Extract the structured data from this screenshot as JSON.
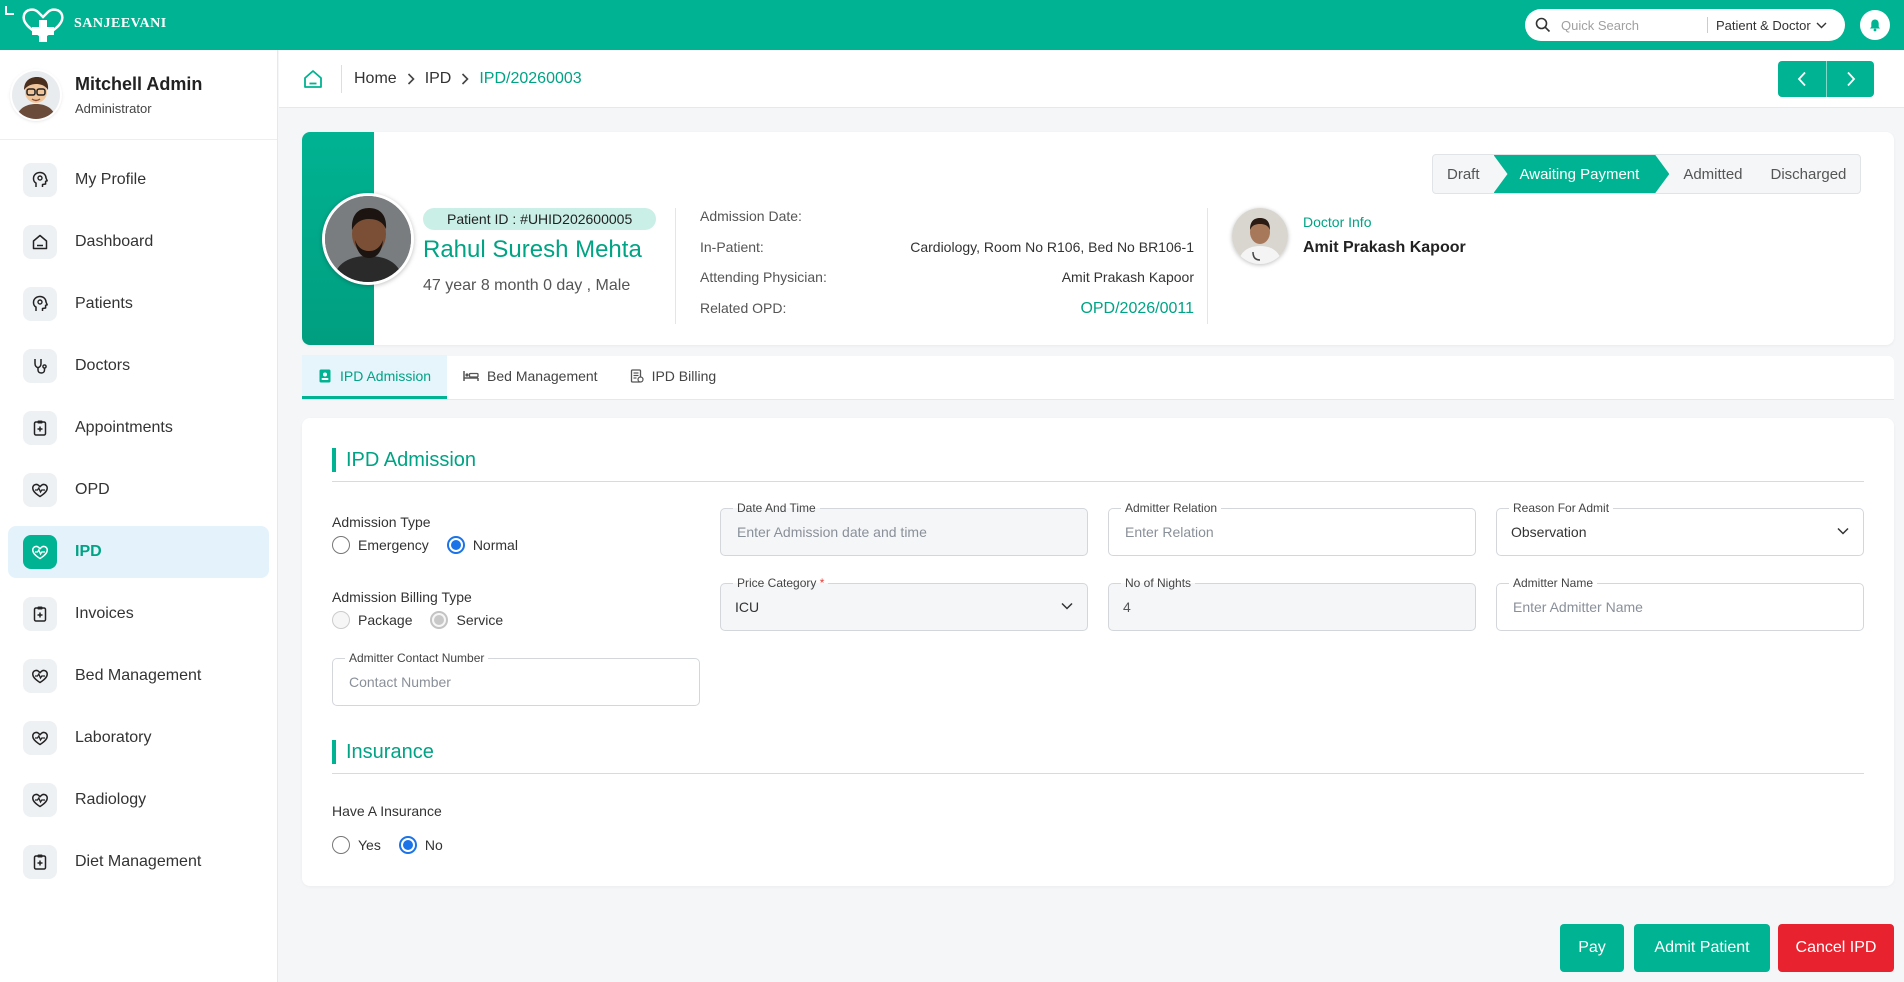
{
  "app": {
    "name": "SANJEEVANI"
  },
  "search": {
    "placeholder": "Quick Search",
    "scope": "Patient & Doctor"
  },
  "user": {
    "name": "Mitchell Admin",
    "role": "Administrator"
  },
  "sidebar": {
    "items": [
      {
        "label": "My Profile"
      },
      {
        "label": "Dashboard"
      },
      {
        "label": "Patients"
      },
      {
        "label": "Doctors"
      },
      {
        "label": "Appointments"
      },
      {
        "label": "OPD"
      },
      {
        "label": "IPD",
        "active": true
      },
      {
        "label": "Invoices"
      },
      {
        "label": "Bed Management"
      },
      {
        "label": "Laboratory"
      },
      {
        "label": "Radiology"
      },
      {
        "label": "Diet Management"
      }
    ]
  },
  "breadcrumb": {
    "home": "Home",
    "section": "IPD",
    "current": "IPD/20260003"
  },
  "patient": {
    "id_label": "Patient ID :",
    "id_value": "#UHID202600005",
    "name": "Rahul Suresh Mehta",
    "age_gender": "47 year 8 month 0 day , Male",
    "info": [
      {
        "label": "Admission Date:",
        "value": ""
      },
      {
        "label": "In-Patient:",
        "value": "Cardiology, Room No R106, Bed No BR106-1"
      },
      {
        "label": "Attending Physician:",
        "value": "Amit Prakash Kapoor"
      },
      {
        "label": "Related OPD:",
        "value": "OPD/2026/0011"
      }
    ]
  },
  "doctor": {
    "label": "Doctor Info",
    "name": "Amit Prakash Kapoor"
  },
  "status": {
    "steps": [
      "Draft",
      "Awaiting Payment",
      "Admitted",
      "Discharged"
    ],
    "active_index": 1
  },
  "tabs": [
    {
      "label": "IPD Admission",
      "icon": "id-badge-icon",
      "active": true
    },
    {
      "label": "Bed Management",
      "icon": "bed-icon"
    },
    {
      "label": "IPD Billing",
      "icon": "receipt-icon"
    }
  ],
  "form": {
    "title": "IPD Admission",
    "admission_type": {
      "label": "Admission Type",
      "options": [
        "Emergency",
        "Normal"
      ],
      "selected": "Normal"
    },
    "billing_type": {
      "label": "Admission Billing Type",
      "options": [
        "Package",
        "Service"
      ],
      "selected": "Service"
    },
    "date_time": {
      "label": "Date And Time",
      "placeholder": "Enter Admission date and time"
    },
    "admitter_relation": {
      "label": "Admitter Relation",
      "placeholder": "Enter Relation"
    },
    "reason": {
      "label": "Reason For Admit",
      "value": "Observation"
    },
    "price_category": {
      "label": "Price Category",
      "required": "*",
      "value": "ICU"
    },
    "nights": {
      "label": "No of Nights",
      "value": "4"
    },
    "admitter_name": {
      "label": "Admitter Name",
      "placeholder": "Enter Admitter Name"
    },
    "contact": {
      "label": "Admitter Contact Number",
      "placeholder": "Contact Number"
    }
  },
  "insurance": {
    "title": "Insurance",
    "question": "Have A Insurance",
    "options": [
      "Yes",
      "No"
    ],
    "selected": "No"
  },
  "actions": {
    "pay": "Pay",
    "admit": "Admit Patient",
    "cancel": "Cancel IPD"
  },
  "colors": {
    "primary": "#00b392",
    "danger": "#e8232f",
    "radio": "#1a73e8"
  }
}
